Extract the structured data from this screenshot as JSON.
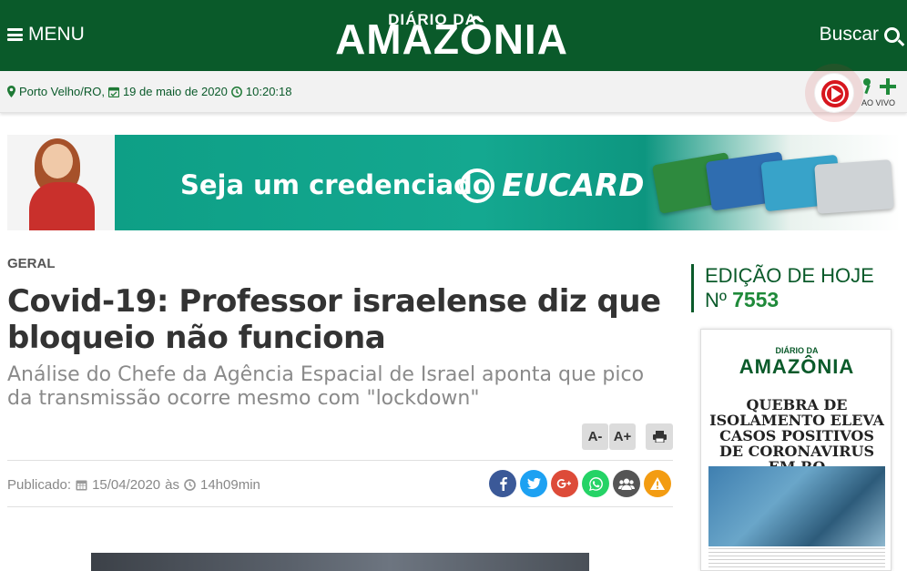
{
  "header": {
    "menu_label": "MENU",
    "logo_top": "DIÁRIO DA",
    "logo_main": "AMAZÔNIA",
    "search_label": "Buscar"
  },
  "infobar": {
    "location": "Porto Velho/RO,",
    "date": "19 de maio de 2020",
    "time": "10:20:18",
    "live_label": "AO VIVO"
  },
  "banner": {
    "headline": "Seja um credenciado",
    "brand": "EUCARD",
    "card_label": "EUCARD"
  },
  "article": {
    "category": "GERAL",
    "title": "Covid-19: Professor israelense diz que bloqueio não funciona",
    "subtitle": "Análise do Chefe da Agência Espacial de Israel aponta que pico da transmissão ocorre mesmo com \"lockdown\"",
    "font_decrease_label": "A-",
    "font_increase_label": "A+",
    "published_label": "Publicado:",
    "published_date": "15/04/2020",
    "published_sep": "às",
    "published_time": "14h09min"
  },
  "sidebar": {
    "edition_label": "EDIÇÃO DE HOJE",
    "edition_prefix": "Nº",
    "edition_number": "7553",
    "cover": {
      "logo_top": "DIÁRIO DA",
      "logo_main": "AMAZÔNIA",
      "headline": "QUEBRA DE ISOLAMENTO ELEVA CASOS POSITIVOS DE CORONAVIRUS EM RO"
    }
  },
  "colors": {
    "brand_green": "#0a5a2a",
    "accent_green": "#1f8a3a",
    "live_red": "#d7161e",
    "facebook": "#3b5998",
    "twitter": "#1da1f2",
    "google_plus": "#dd4b39",
    "whatsapp": "#25d366",
    "group": "#555555",
    "alert": "#f39c12"
  },
  "icons": {
    "menu": "hamburger-icon",
    "search": "search-icon",
    "location": "map-marker-icon",
    "calendar": "calendar-icon",
    "clock": "clock-icon",
    "play": "play-icon",
    "mic": "microphone-icon",
    "plus": "plus-icon",
    "print": "print-icon",
    "facebook": "facebook-icon",
    "twitter": "twitter-icon",
    "google_plus": "google-plus-icon",
    "whatsapp": "whatsapp-icon",
    "group": "group-icon",
    "alert": "alert-icon"
  }
}
